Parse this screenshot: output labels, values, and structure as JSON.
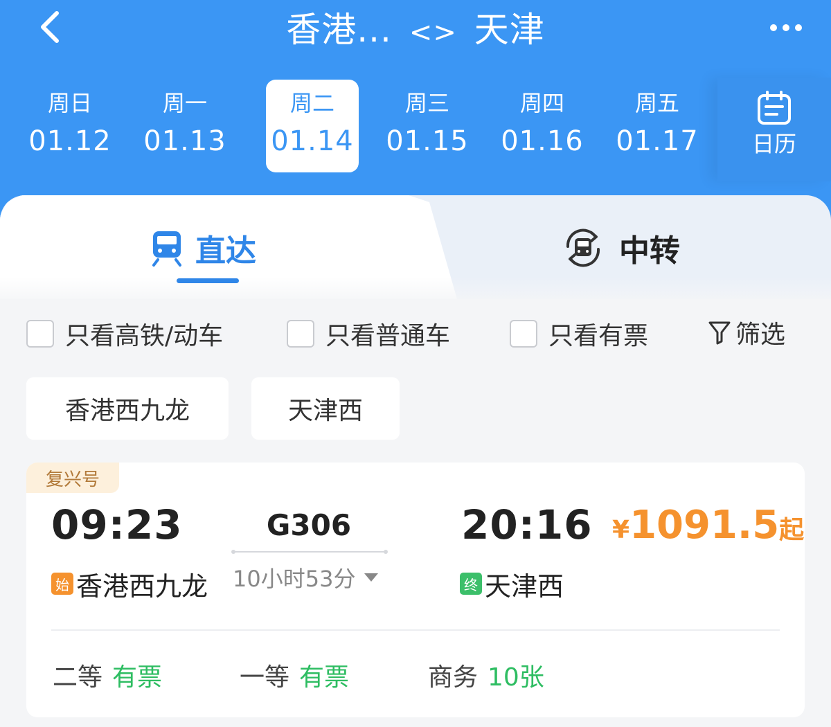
{
  "header": {
    "title_from": "香港...",
    "title_sep": "<>",
    "title_to": "天津",
    "back_icon": "chevron-left-icon",
    "more_icon": "more-horizontal-icon"
  },
  "dates": [
    {
      "dow": "周日",
      "date": "01.12",
      "active": false
    },
    {
      "dow": "周一",
      "date": "01.13",
      "active": false
    },
    {
      "dow": "周二",
      "date": "01.14",
      "active": true
    },
    {
      "dow": "周三",
      "date": "01.15",
      "active": false
    },
    {
      "dow": "周四",
      "date": "01.16",
      "active": false
    },
    {
      "dow": "周五",
      "date": "01.17",
      "active": false
    }
  ],
  "calendar": {
    "label": "日历",
    "icon": "calendar-icon"
  },
  "tabs": {
    "direct": {
      "label": "直达",
      "icon": "train-icon",
      "active": true
    },
    "transfer": {
      "label": "中转",
      "icon": "transfer-train-icon",
      "active": false
    }
  },
  "filters": {
    "hsr_only": "只看高铁/动车",
    "normal_only": "只看普通车",
    "available_only": "只看有票",
    "filter_label": "筛选",
    "filter_icon": "funnel-icon"
  },
  "stations": {
    "chip_from": "香港西九龙",
    "chip_to": "天津西"
  },
  "train": {
    "badge": "复兴号",
    "departure_time": "09:23",
    "arrival_time": "20:16",
    "train_number": "G306",
    "duration": "10小时53分",
    "start_tag": "始",
    "end_tag": "终",
    "from_station": "香港西九龙",
    "to_station": "天津西",
    "price_currency": "¥",
    "price_value": "1091.5",
    "price_suffix": "起",
    "seats": [
      {
        "class": "二等",
        "availability": "有票"
      },
      {
        "class": "一等",
        "availability": "有票"
      },
      {
        "class": "商务",
        "availability": "10张"
      }
    ]
  },
  "colors": {
    "brand_blue": "#3b96f4",
    "accent_orange": "#f5922e",
    "available_green": "#2ebd62",
    "badge_bg": "#fdf0dc"
  }
}
